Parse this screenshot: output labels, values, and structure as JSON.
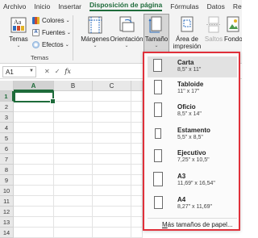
{
  "tabs": [
    "Archivo",
    "Inicio",
    "Insertar",
    "Disposición de página",
    "Fórmulas",
    "Datos",
    "Revisar"
  ],
  "active_tab_index": 3,
  "ribbon": {
    "temas_label": "Temas",
    "colores_label": "Colores",
    "fuentes_label": "Fuentes",
    "efectos_label": "Efectos",
    "temas_group_label": "Temas",
    "margenes_label": "Márgenes",
    "orientacion_label": "Orientación",
    "tamano_label": "Tamaño",
    "area_label_1": "Área de",
    "area_label_2": "impresión",
    "saltos_label": "Saltos",
    "fondo_label": "Fondo"
  },
  "formula_bar": {
    "name_box": "A1",
    "cancel_symbol": "✕",
    "enter_symbol": "✓",
    "fx_label": "fx"
  },
  "sheet": {
    "columns": [
      "A",
      "B",
      "C"
    ],
    "rows": [
      "1",
      "2",
      "3",
      "4",
      "5",
      "6",
      "7",
      "8",
      "9",
      "10",
      "11",
      "12",
      "13",
      "14"
    ]
  },
  "size_menu": {
    "items": [
      {
        "name": "Carta",
        "dims": "8,5\" x 11\""
      },
      {
        "name": "Tabloide",
        "dims": "11\" x 17\""
      },
      {
        "name": "Oficio",
        "dims": "8,5\" x 14\""
      },
      {
        "name": "Estamento",
        "dims": "5,5\" x 8,5\""
      },
      {
        "name": "Ejecutivo",
        "dims": "7,25\" x 10,5\""
      },
      {
        "name": "A3",
        "dims": "11,69\" x 16,54\""
      },
      {
        "name": "A4",
        "dims": "8,27\" x 11,69\""
      }
    ],
    "selected_index": 0,
    "more_prefix": "M",
    "more_rest": "ás tamaños de papel..."
  },
  "colors": {
    "accent": "#1e6b3a",
    "highlight_border": "#e0303a"
  }
}
